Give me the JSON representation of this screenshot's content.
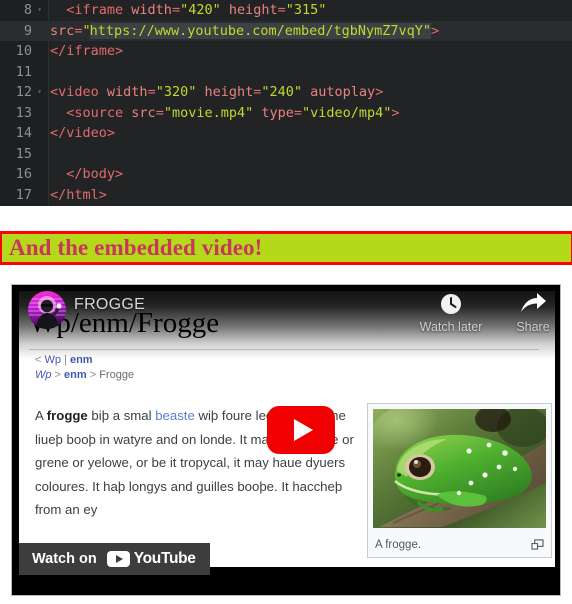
{
  "editor": {
    "name": "html-code-editor",
    "background": "#212325",
    "gutter_background": "#1d1f21",
    "highlighted_line": 9,
    "lines": [
      {
        "num": "8",
        "fold": "▾",
        "indent": "  ",
        "segments": [
          {
            "t": "<iframe",
            "c": "tag"
          },
          {
            "t": " width",
            "c": "attr"
          },
          {
            "t": "=",
            "c": "punct"
          },
          {
            "t": "\"420\"",
            "c": "str"
          },
          {
            "t": " height",
            "c": "attr"
          },
          {
            "t": "=",
            "c": "punct"
          },
          {
            "t": "\"315\"",
            "c": "str"
          }
        ]
      },
      {
        "num": "9",
        "fold": "",
        "indent": "",
        "segments": [
          {
            "t": "src",
            "c": "attr"
          },
          {
            "t": "=",
            "c": "punct"
          },
          {
            "t": "\"",
            "c": "str"
          },
          {
            "t": "CARET",
            "c": "caret"
          },
          {
            "t": "https://www.youtube.com/embed/tgbNymZ7vqY\"",
            "c": "str sel"
          },
          {
            "t": ">",
            "c": "punct"
          }
        ]
      },
      {
        "num": "10",
        "fold": "",
        "indent": "",
        "segments": [
          {
            "t": "</iframe>",
            "c": "tag"
          }
        ]
      },
      {
        "num": "11",
        "fold": "",
        "indent": "",
        "segments": []
      },
      {
        "num": "12",
        "fold": "▾",
        "indent": "",
        "segments": [
          {
            "t": "<video",
            "c": "tag"
          },
          {
            "t": " width",
            "c": "attr"
          },
          {
            "t": "=",
            "c": "punct"
          },
          {
            "t": "\"320\"",
            "c": "str"
          },
          {
            "t": " height",
            "c": "attr"
          },
          {
            "t": "=",
            "c": "punct"
          },
          {
            "t": "\"240\"",
            "c": "str"
          },
          {
            "t": " autoplay",
            "c": "attr"
          },
          {
            "t": ">",
            "c": "tag"
          }
        ]
      },
      {
        "num": "13",
        "fold": "",
        "indent": "  ",
        "segments": [
          {
            "t": "<source",
            "c": "tag"
          },
          {
            "t": " src",
            "c": "attr"
          },
          {
            "t": "=",
            "c": "punct"
          },
          {
            "t": "\"movie.mp4\"",
            "c": "str"
          },
          {
            "t": " type",
            "c": "attr"
          },
          {
            "t": "=",
            "c": "punct"
          },
          {
            "t": "\"video/mp4\"",
            "c": "str"
          },
          {
            "t": ">",
            "c": "tag"
          }
        ]
      },
      {
        "num": "14",
        "fold": "",
        "indent": "",
        "segments": [
          {
            "t": "</video>",
            "c": "tag"
          }
        ]
      },
      {
        "num": "15",
        "fold": "",
        "indent": "",
        "segments": []
      },
      {
        "num": "16",
        "fold": "",
        "indent": "  ",
        "segments": [
          {
            "t": "</body>",
            "c": "tag"
          }
        ]
      },
      {
        "num": "17",
        "fold": "",
        "indent": "",
        "segments": [
          {
            "t": "</html>",
            "c": "tag"
          }
        ]
      }
    ]
  },
  "banner": {
    "text": "And the embedded video!",
    "background_color": "#b3d91a",
    "border_color": "#ff0000",
    "text_color": "#c8365c"
  },
  "video_player": {
    "channel_name": "FROGGE",
    "watch_later_label": "Watch later",
    "share_label": "Share",
    "watch_on_label": "Watch on",
    "youtube_wordmark": "YouTube",
    "play_button_color": "#f00000"
  },
  "wiki_page": {
    "title": "Wp/enm/Frogge",
    "breadcrumb_top": {
      "prefix": "< ",
      "link1": "Wp",
      "sep": " | ",
      "link2": "enm"
    },
    "breadcrumb_path": {
      "link1": "Wp",
      "sep1": " > ",
      "link2": "enm",
      "sep2": " > ",
      "current": "Frogge"
    },
    "body_paragraph": {
      "lead_a": "A ",
      "lead_bold": "frogge",
      "text_1": " biþ a smal ",
      "link_1": "beaste",
      "text_2": " wiþ foure leggys, whyche liueþ booþ in watyre and on londe. It may be broune or grene or yelowe, or be it tropycal, it may haue dyuers coloures. It haþ longys and guilles booþe. It haccheþ from an ey"
    },
    "thumbnail_caption": "A frogge.",
    "thumbnail_alt": "green tree frog on a branch"
  }
}
